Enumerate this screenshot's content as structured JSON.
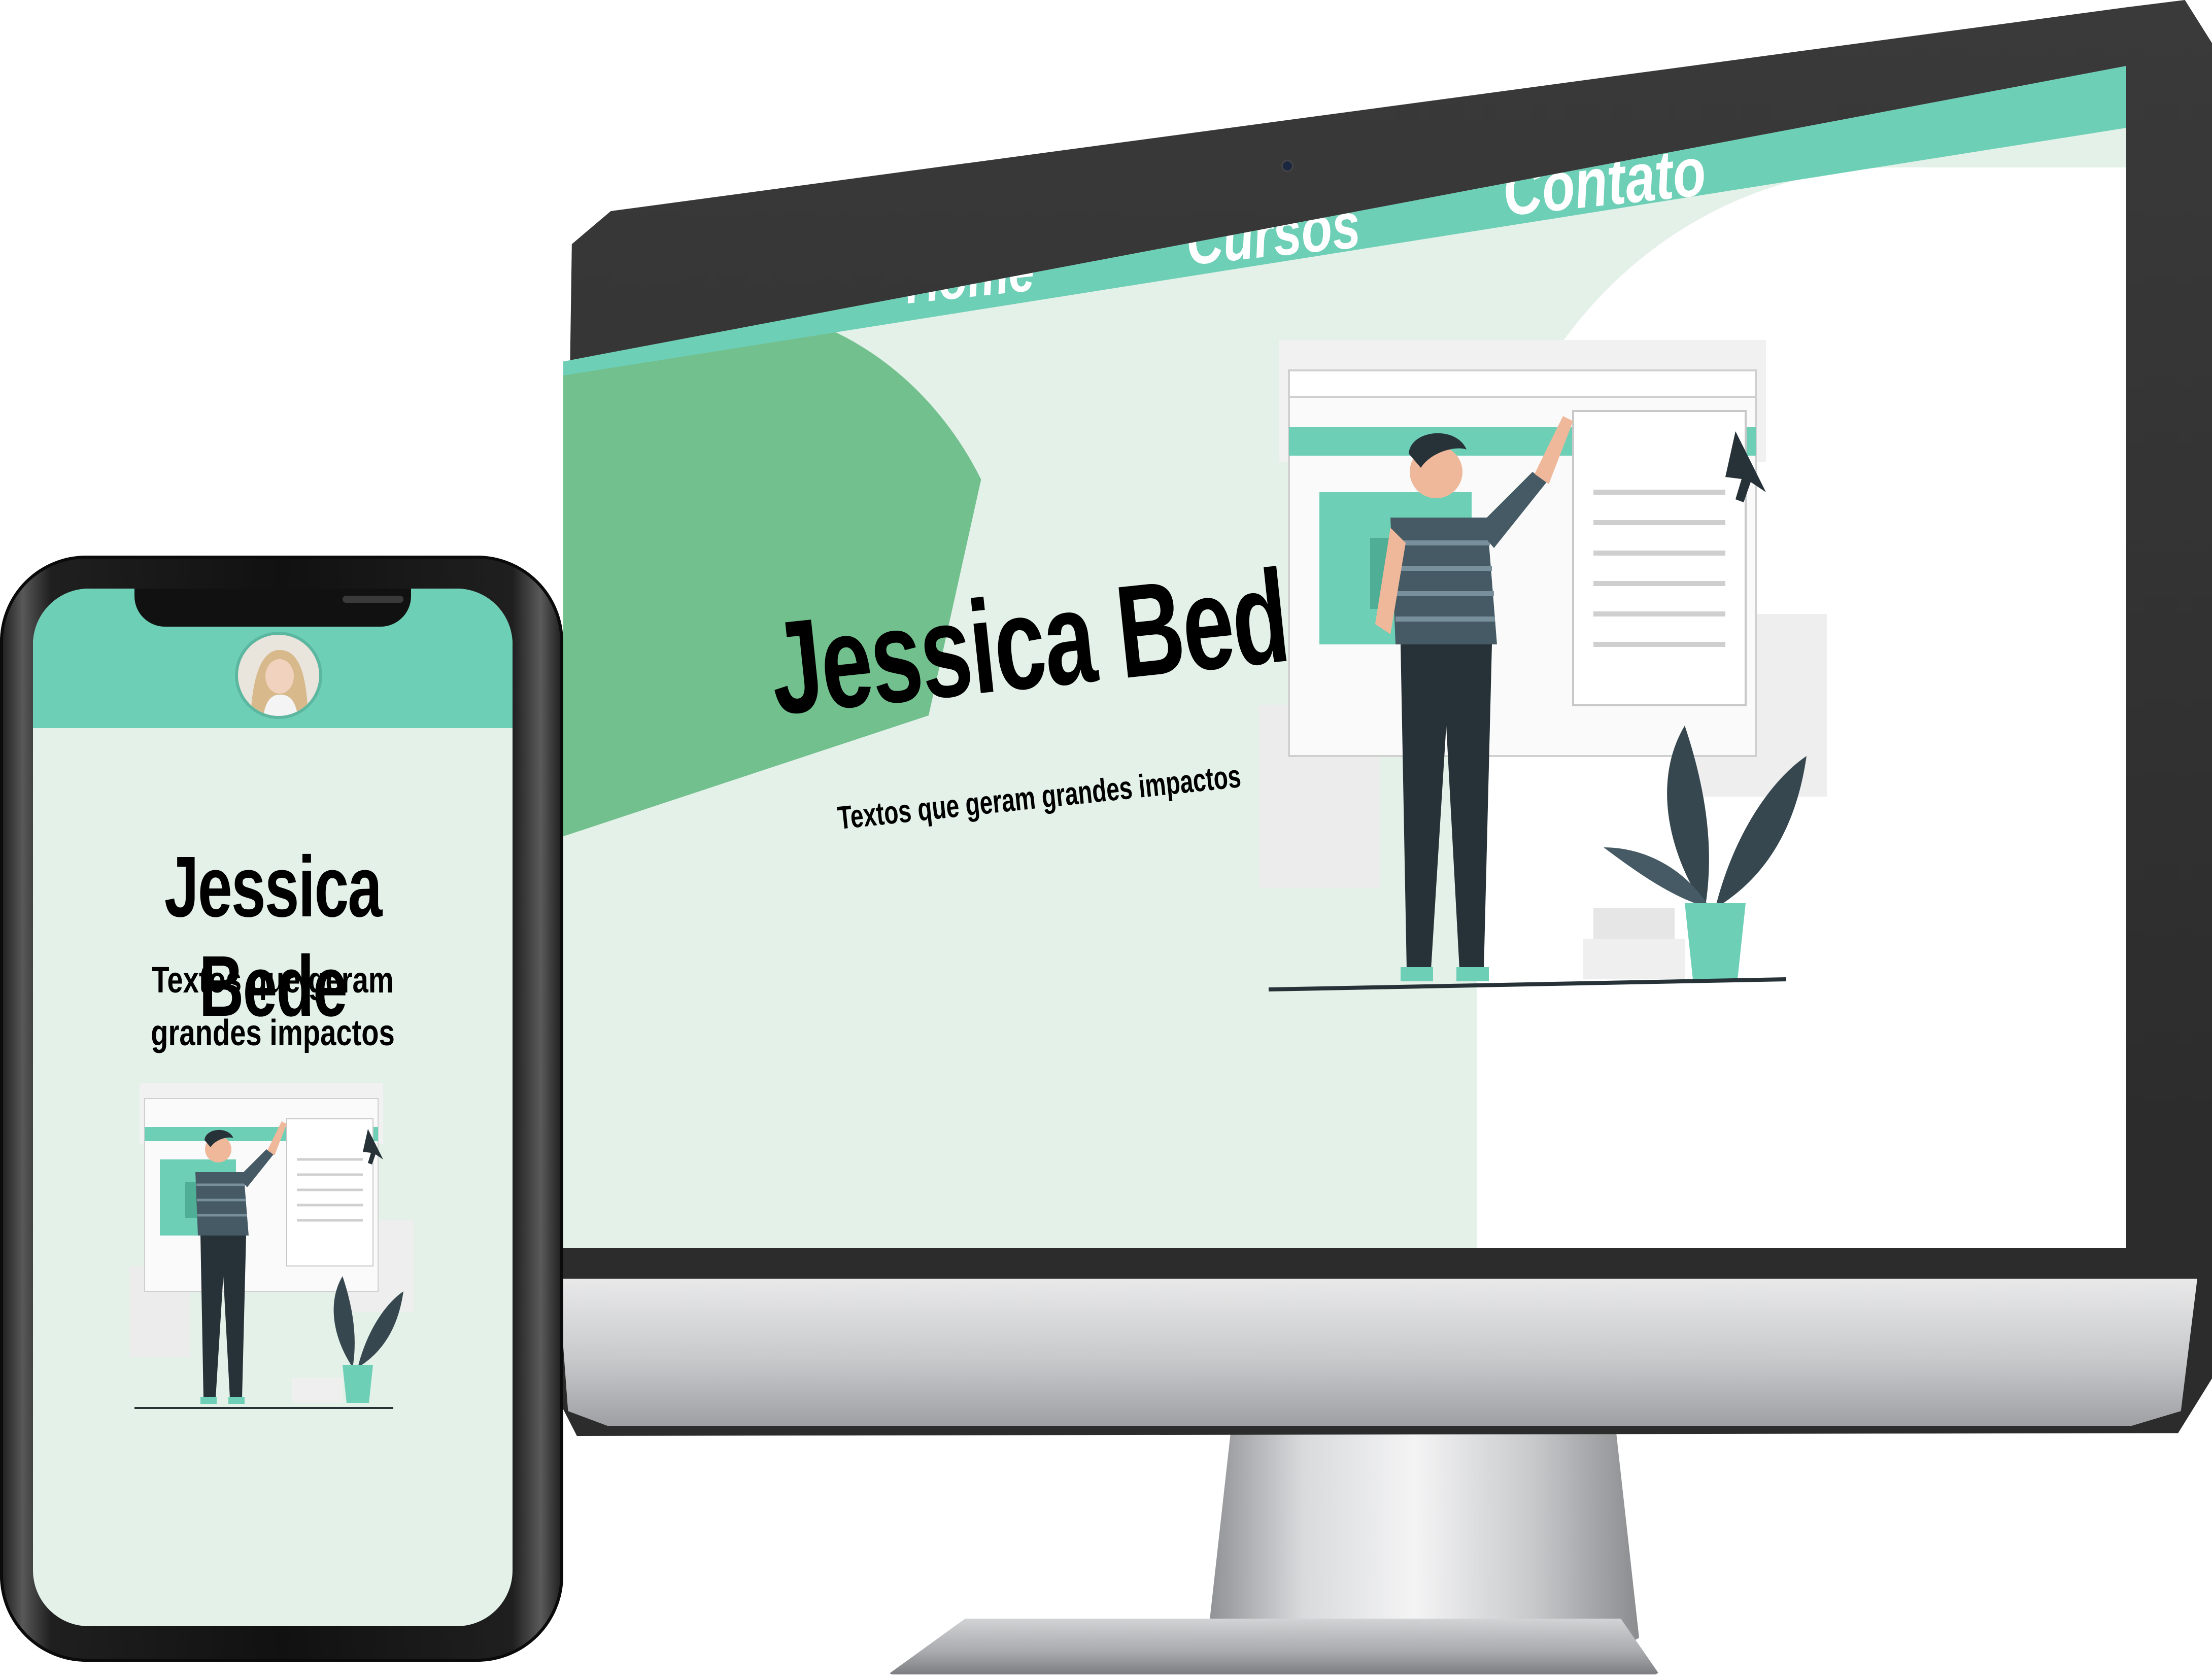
{
  "colors": {
    "accent": "#6ecfb7",
    "background": "#e3f1e8",
    "blob": "#72c08e",
    "figure_dark": "#263238",
    "text": "#000000"
  },
  "desktop": {
    "nav": {
      "items": [
        {
          "label": "Home"
        },
        {
          "label": "Cursos"
        },
        {
          "label": "Contato"
        }
      ]
    },
    "hero": {
      "title": "Jessica Bede",
      "subtitle": "Textos que geram grandes impactos",
      "illustration": "person-pointing-at-web-page-illustration"
    }
  },
  "mobile": {
    "header": {
      "avatar": "profile-photo"
    },
    "hero": {
      "title": "Jessica Bede",
      "subtitle": "Textos que geram grandes impactos",
      "illustration": "person-pointing-at-web-page-illustration"
    }
  }
}
